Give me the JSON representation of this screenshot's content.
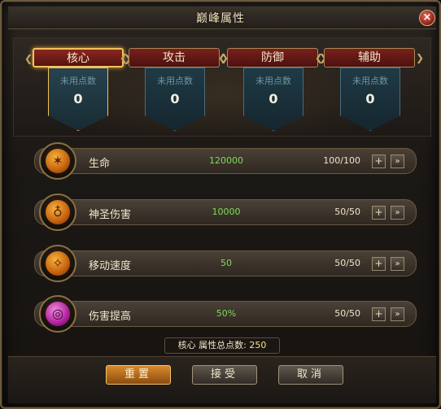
{
  "window": {
    "title": "巅峰属性",
    "close_label": "×"
  },
  "tabs": [
    {
      "label": "核心",
      "active": true
    },
    {
      "label": "攻击",
      "active": false
    },
    {
      "label": "防御",
      "active": false
    },
    {
      "label": "辅助",
      "active": false
    }
  ],
  "banners": [
    {
      "label": "未用点数",
      "value": "0"
    },
    {
      "label": "未用点数",
      "value": "0"
    },
    {
      "label": "未用点数",
      "value": "0"
    },
    {
      "label": "未用点数",
      "value": "0"
    }
  ],
  "attributes": [
    {
      "name": "生命",
      "value": "120000",
      "level": "100/100",
      "icon": "life-rune-icon",
      "glyph": "✶"
    },
    {
      "name": "神圣伤害",
      "value": "10000",
      "level": "50/50",
      "icon": "holy-damage-rune-icon",
      "glyph": "♁"
    },
    {
      "name": "移动速度",
      "value": "50",
      "level": "50/50",
      "icon": "move-speed-rune-icon",
      "glyph": "✧"
    },
    {
      "name": "伤害提高",
      "value": "50%",
      "level": "50/50",
      "icon": "damage-boost-rune-icon",
      "glyph": "◎"
    }
  ],
  "row_buttons": {
    "plus": "+",
    "max": "»"
  },
  "total": {
    "prefix": "核心 属性总点数:",
    "value": "250"
  },
  "actions": {
    "reset": "重置",
    "accept": "接受",
    "cancel": "取消"
  }
}
